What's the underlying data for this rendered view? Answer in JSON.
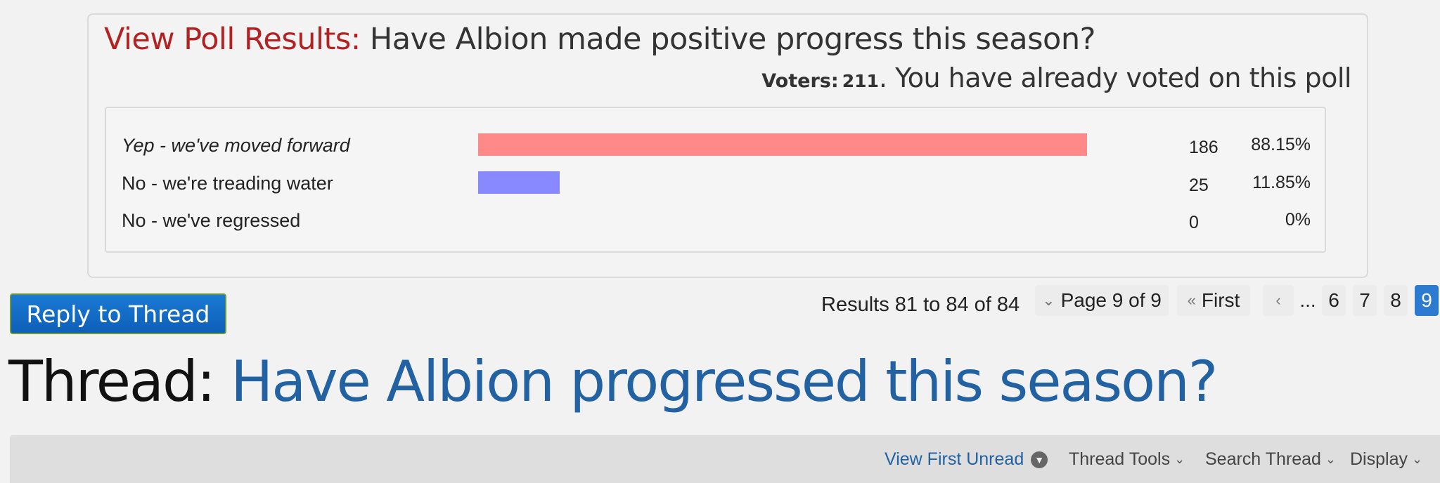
{
  "poll": {
    "results_label": "View Poll Results:",
    "question": "Have Albion made positive progress this season?",
    "voters_label": "Voters:",
    "voters_count": "211",
    "voted_message": ". You have already voted on this poll",
    "options": [
      {
        "label": "Yep - we've moved forward",
        "count": "186",
        "percent": "88.15%",
        "fraction": 0.8815,
        "color": "#ff8888"
      },
      {
        "label": "No - we're treading water",
        "count": "25",
        "percent": "11.85%",
        "fraction": 0.1185,
        "color": "#8888ff"
      },
      {
        "label": "No - we've regressed",
        "count": "0",
        "percent": "0%",
        "fraction": 0,
        "color": "#8888ff"
      }
    ]
  },
  "reply_button": "Reply to Thread",
  "pagination": {
    "results_text": "Results 81 to 84 of 84",
    "page_label": "Page 9 of 9",
    "first_label": "First",
    "prev_icon": "chevron-left-icon",
    "ellipsis": "...",
    "pages": [
      "6",
      "7",
      "8",
      "9"
    ],
    "current_page": "9"
  },
  "thread": {
    "label": "Thread:",
    "name": "Have Albion progressed this season?"
  },
  "toolbar": {
    "view_first_unread": "View First Unread",
    "thread_tools": "Thread Tools",
    "search_thread": "Search Thread",
    "display": "Display"
  }
}
